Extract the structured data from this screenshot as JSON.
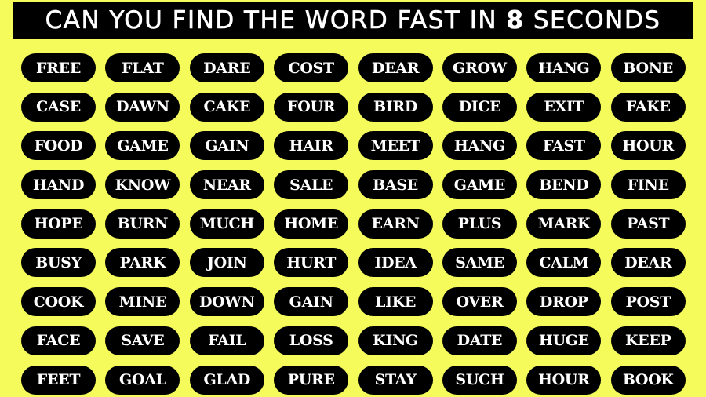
{
  "puzzle": {
    "title": "CAN YOU FIND THE WORD FAST IN 8 SECONDS",
    "title_parts": {
      "before": "CAN YOU FIND THE WORD FAST IN ",
      "number": "8",
      "after": " SECONDS"
    },
    "target_word": "FAST",
    "time_limit_seconds": 8,
    "colors": {
      "background": "#f4fb5a",
      "pill": "#000000",
      "text": "#ffffff"
    },
    "columns": 8,
    "rows": [
      [
        "FREE",
        "FLAT",
        "DARE",
        "COST",
        "DEAR",
        "GROW",
        "HANG",
        "BONE"
      ],
      [
        "CASE",
        "DAWN",
        "CAKE",
        "FOUR",
        "BIRD",
        "DICE",
        "EXIT",
        "FAKE"
      ],
      [
        "FOOD",
        "GAME",
        "GAIN",
        "HAIR",
        "MEET",
        "HANG",
        "FAST",
        "HOUR"
      ],
      [
        "HAND",
        "KNOW",
        "NEAR",
        "SALE",
        "BASE",
        "GAME",
        "BEND",
        "FINE"
      ],
      [
        "HOPE",
        "BURN",
        "MUCH",
        "HOME",
        "EARN",
        "PLUS",
        "MARK",
        "PAST"
      ],
      [
        "BUSY",
        "PARK",
        "JOIN",
        "HURT",
        "IDEA",
        "SAME",
        "CALM",
        "DEAR"
      ],
      [
        "COOK",
        "MINE",
        "DOWN",
        "GAIN",
        "LIKE",
        "OVER",
        "DROP",
        "POST"
      ],
      [
        "FACE",
        "SAVE",
        "FAIL",
        "LOSS",
        "KING",
        "DATE",
        "HUGE",
        "KEEP"
      ],
      [
        "FEET",
        "GOAL",
        "GLAD",
        "PURE",
        "STAY",
        "SUCH",
        "HOUR",
        "BOOK"
      ]
    ]
  }
}
